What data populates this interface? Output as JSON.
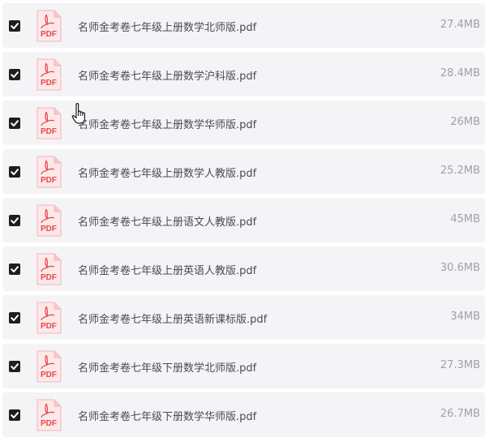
{
  "colors": {
    "row_bg": "#f4f4f7",
    "checkbox": "#1e1e1e",
    "pdf_red": "#e5484d",
    "filename_text": "#4a4a50",
    "size_text": "#a0a0a6"
  },
  "files": [
    {
      "name": "名师金考卷七年级上册数学北师版.pdf",
      "size": "27.4MB",
      "checked": true,
      "icon": "pdf-icon"
    },
    {
      "name": "名师金考卷七年级上册数学沪科版.pdf",
      "size": "28.4MB",
      "checked": true,
      "icon": "pdf-icon"
    },
    {
      "name": "名师金考卷七年级上册数学华师版.pdf",
      "size": "26MB",
      "checked": true,
      "icon": "pdf-icon"
    },
    {
      "name": "名师金考卷七年级上册数学人教版.pdf",
      "size": "25.2MB",
      "checked": true,
      "icon": "pdf-icon"
    },
    {
      "name": "名师金考卷七年级上册语文人教版.pdf",
      "size": "45MB",
      "checked": true,
      "icon": "pdf-icon"
    },
    {
      "name": "名师金考卷七年级上册英语人教版.pdf",
      "size": "30.6MB",
      "checked": true,
      "icon": "pdf-icon"
    },
    {
      "name": "名师金考卷七年级上册英语新课标版.pdf",
      "size": "34MB",
      "checked": true,
      "icon": "pdf-icon"
    },
    {
      "name": "名师金考卷七年级下册数学北师版.pdf",
      "size": "27.3MB",
      "checked": true,
      "icon": "pdf-icon"
    },
    {
      "name": "名师金考卷七年级下册数学华师版.pdf",
      "size": "26.7MB",
      "checked": true,
      "icon": "pdf-icon"
    }
  ],
  "pdf_icon_label": "PDF"
}
